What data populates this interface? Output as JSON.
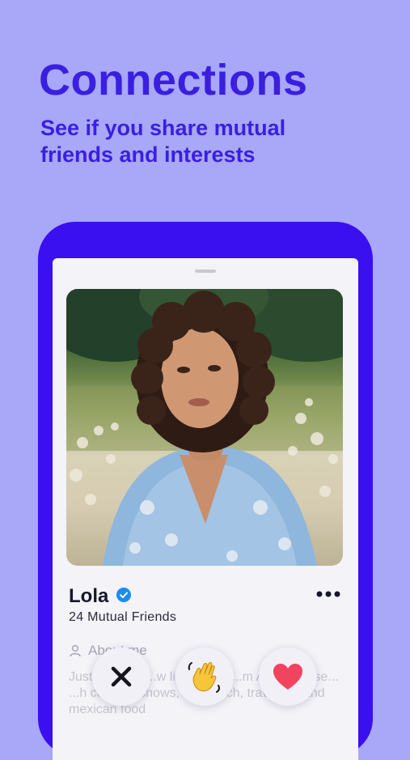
{
  "header": {
    "title": "Connections",
    "subtitle": "See if you share mutual friends and interests"
  },
  "profile": {
    "name": "Lola",
    "mutual_friends": "24 Mutual Friends",
    "about_label": "About me",
    "bio": "Just ... at Y... ...w li... Origi... ...m Au... ...Obse... ...h comedy shows, the beach, traveling, and mexican food"
  },
  "icons": {
    "verified": "verified-badge-icon",
    "more": "more-options-icon",
    "about": "person-icon",
    "pass": "close-x-icon",
    "wave": "waving-hand-icon",
    "like": "heart-icon"
  },
  "colors": {
    "background": "#a9a7f7",
    "brand": "#3a1fe0",
    "phone_frame": "#3a10f0",
    "verified": "#1a8cf0",
    "heart": "#f2435f"
  }
}
